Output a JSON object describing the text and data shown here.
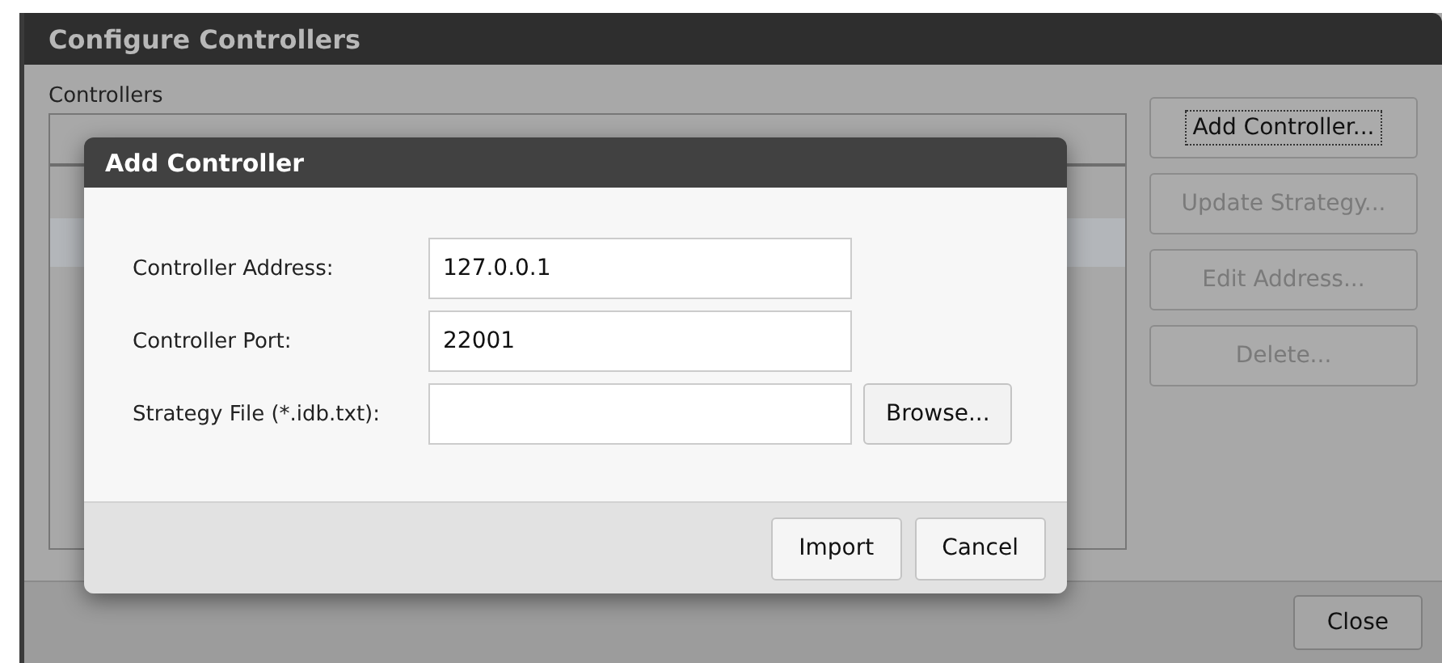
{
  "window": {
    "title": "Configure Controllers"
  },
  "controllers": {
    "label": "Controllers",
    "selected_row": true
  },
  "side_buttons": [
    {
      "label": "Add Controller...",
      "disabled": false,
      "focused": true
    },
    {
      "label": "Update Strategy...",
      "disabled": true,
      "focused": false
    },
    {
      "label": "Edit Address...",
      "disabled": true,
      "focused": false
    },
    {
      "label": "Delete...",
      "disabled": true,
      "focused": false
    }
  ],
  "footer_buttons": [
    "Close"
  ],
  "dialog": {
    "title": "Add Controller",
    "fields": [
      {
        "label": "Controller Address:",
        "value": "127.0.0.1"
      },
      {
        "label": "Controller Port:",
        "value": "22001"
      },
      {
        "label": "Strategy File (*.idb.txt):",
        "button": "Browse..."
      }
    ],
    "buttons": [
      "Import",
      "Cancel"
    ]
  }
}
